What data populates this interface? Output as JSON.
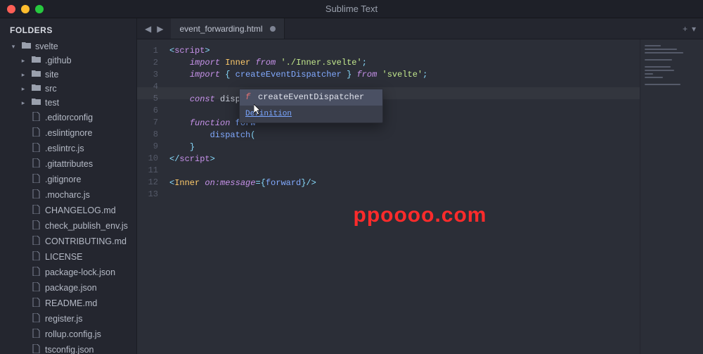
{
  "app_title": "Sublime Text",
  "sidebar": {
    "header": "FOLDERS",
    "root": {
      "name": "svelte",
      "expanded": true
    },
    "folders": [
      {
        "name": ".github"
      },
      {
        "name": "site"
      },
      {
        "name": "src"
      },
      {
        "name": "test"
      }
    ],
    "files": [
      ".editorconfig",
      ".eslintignore",
      ".eslintrc.js",
      ".gitattributes",
      ".gitignore",
      ".mocharc.js",
      "CHANGELOG.md",
      "check_publish_env.js",
      "CONTRIBUTING.md",
      "LICENSE",
      "package-lock.json",
      "package.json",
      "README.md",
      "register.js",
      "rollup.config.js",
      "tsconfig.json"
    ]
  },
  "tabs": {
    "active": {
      "title": "event_forwarding.html",
      "dirty": true
    }
  },
  "editor": {
    "highlight_line": 5,
    "lines": [
      [
        {
          "c": "tk-punct",
          "t": "<"
        },
        {
          "c": "tk-tag",
          "t": "script"
        },
        {
          "c": "tk-punct",
          "t": ">"
        }
      ],
      [
        {
          "c": "",
          "t": "    "
        },
        {
          "c": "tk-kw",
          "t": "import"
        },
        {
          "c": "",
          "t": " "
        },
        {
          "c": "tk-type",
          "t": "Inner"
        },
        {
          "c": "",
          "t": " "
        },
        {
          "c": "tk-kw",
          "t": "from"
        },
        {
          "c": "",
          "t": " "
        },
        {
          "c": "tk-str",
          "t": "'./Inner.svelte'"
        },
        {
          "c": "tk-punct",
          "t": ";"
        }
      ],
      [
        {
          "c": "",
          "t": "    "
        },
        {
          "c": "tk-kw",
          "t": "import"
        },
        {
          "c": "",
          "t": " "
        },
        {
          "c": "tk-punct",
          "t": "{ "
        },
        {
          "c": "tk-id",
          "t": "createEventDispatcher"
        },
        {
          "c": "tk-punct",
          "t": " }"
        },
        {
          "c": "",
          "t": " "
        },
        {
          "c": "tk-kw",
          "t": "from"
        },
        {
          "c": "",
          "t": " "
        },
        {
          "c": "tk-str",
          "t": "'svelte'"
        },
        {
          "c": "tk-punct",
          "t": ";"
        }
      ],
      [],
      [
        {
          "c": "",
          "t": "    "
        },
        {
          "c": "tk-kw",
          "t": "const"
        },
        {
          "c": "",
          "t": " "
        },
        {
          "c": "tk-txt",
          "t": "dispatch"
        },
        {
          "c": "",
          "t": " "
        },
        {
          "c": "tk-punct",
          "t": "="
        },
        {
          "c": "",
          "t": " "
        },
        {
          "c": "tk-id",
          "t": "cre"
        }
      ],
      [],
      [
        {
          "c": "",
          "t": "    "
        },
        {
          "c": "tk-kw",
          "t": "function"
        },
        {
          "c": "",
          "t": " "
        },
        {
          "c": "tk-id",
          "t": "forw"
        }
      ],
      [
        {
          "c": "",
          "t": "        "
        },
        {
          "c": "tk-id",
          "t": "dispatch"
        },
        {
          "c": "tk-punct",
          "t": "("
        },
        {
          "c": "",
          "t": " "
        }
      ],
      [
        {
          "c": "",
          "t": "    "
        },
        {
          "c": "tk-punct",
          "t": "}"
        }
      ],
      [
        {
          "c": "tk-punct",
          "t": "</"
        },
        {
          "c": "tk-tag",
          "t": "script"
        },
        {
          "c": "tk-punct",
          "t": ">"
        }
      ],
      [],
      [
        {
          "c": "tk-punct",
          "t": "<"
        },
        {
          "c": "tk-type",
          "t": "Inner"
        },
        {
          "c": "",
          "t": " "
        },
        {
          "c": "tk-attr",
          "t": "on:message"
        },
        {
          "c": "tk-punct",
          "t": "={"
        },
        {
          "c": "tk-id",
          "t": "forward"
        },
        {
          "c": "tk-punct",
          "t": "}/>"
        }
      ],
      []
    ]
  },
  "autocomplete": {
    "kind_glyph": "f",
    "selected_label": "createEventDispatcher",
    "footer_link": "Definition"
  },
  "minimap_widths": [
    30,
    60,
    72,
    0,
    50,
    0,
    48,
    55,
    16,
    34,
    0,
    66,
    0
  ],
  "watermark": "ppoooo.com",
  "plus_glyph": "+",
  "chevron_left": "◀",
  "chevron_right": "▶",
  "chevron_down": "▾"
}
